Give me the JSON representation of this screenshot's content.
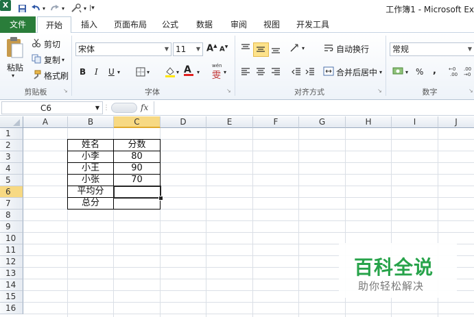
{
  "app": {
    "logo_letter": "X",
    "window_title": "工作簿1 - Microsoft Ex"
  },
  "tabs": [
    "文件",
    "开始",
    "插入",
    "页面布局",
    "公式",
    "数据",
    "审阅",
    "视图",
    "开发工具"
  ],
  "clipboard": {
    "paste": "粘贴",
    "cut": "剪切",
    "copy": "复制",
    "format_painter": "格式刷",
    "group": "剪贴板"
  },
  "font": {
    "name": "宋体",
    "size": "11",
    "bold": "B",
    "italic": "I",
    "underline": "U",
    "font_color_letter": "A",
    "grow": "A",
    "shrink": "A",
    "wen": "wén",
    "group": "字体"
  },
  "alignment": {
    "wrap": "自动换行",
    "merge": "合并后居中",
    "group": "对齐方式"
  },
  "number": {
    "format": "常规",
    "percent": "%",
    "comma": ",",
    "group": "数字"
  },
  "formula_bar": {
    "name_box": "C6",
    "fx": "fx",
    "value": ""
  },
  "sheet": {
    "columns": [
      "A",
      "B",
      "C",
      "D",
      "E",
      "F",
      "G",
      "H",
      "I",
      "J"
    ],
    "rows": [
      "1",
      "2",
      "3",
      "4",
      "5",
      "6",
      "7",
      "8",
      "9",
      "10",
      "11",
      "12",
      "13",
      "14",
      "15",
      "16"
    ],
    "selected_cell": "C6",
    "table": {
      "headers": [
        "姓名",
        "分数"
      ],
      "rows": [
        [
          "小李",
          "80"
        ],
        [
          "小王",
          "90"
        ],
        [
          "小张",
          "70"
        ],
        [
          "平均分",
          ""
        ],
        [
          "总分",
          ""
        ]
      ]
    }
  },
  "watermark": {
    "title": "百科全说",
    "subtitle": "助你轻松解决"
  },
  "colors": {
    "file_tab": "#2a7d3a",
    "selected_header": "#f7d983",
    "watermark_green": "#27a34a"
  }
}
